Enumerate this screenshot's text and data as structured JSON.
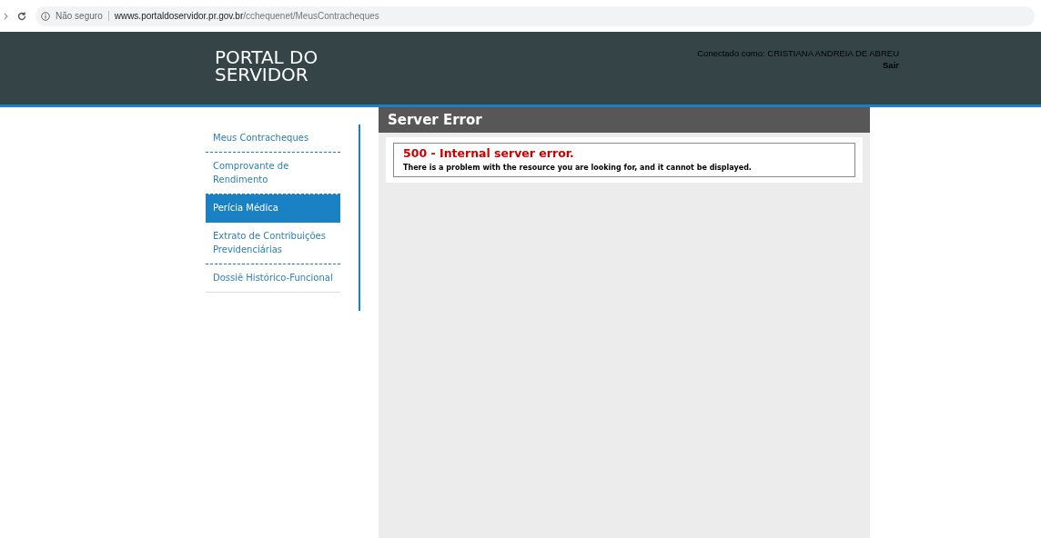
{
  "browser": {
    "security": "Não seguro",
    "url_host": "wwws.portaldoservidor.pr.gov.br",
    "url_path": "/cchequenet/MeusContracheques"
  },
  "header": {
    "logo": "PORTAL DO SERVIDOR",
    "user": "Conectado como: CRISTIANA ANDREIA DE ABREU",
    "logout": "Sair"
  },
  "sidebar": {
    "items": [
      {
        "label": "Meus Contracheques",
        "selected": false
      },
      {
        "label": "Comprovante de Rendimento",
        "selected": false
      },
      {
        "label": "Perícia Médica",
        "selected": true
      },
      {
        "label": "Extrato de Contribuições Previdenciárias",
        "selected": false
      },
      {
        "label": "Dossiê Histórico-Funcional",
        "selected": false
      }
    ]
  },
  "panel": {
    "title": "Server Error",
    "error_title": "500 - Internal server error.",
    "error_message": "There is a problem with the resource you are looking for, and it cannot be displayed."
  }
}
